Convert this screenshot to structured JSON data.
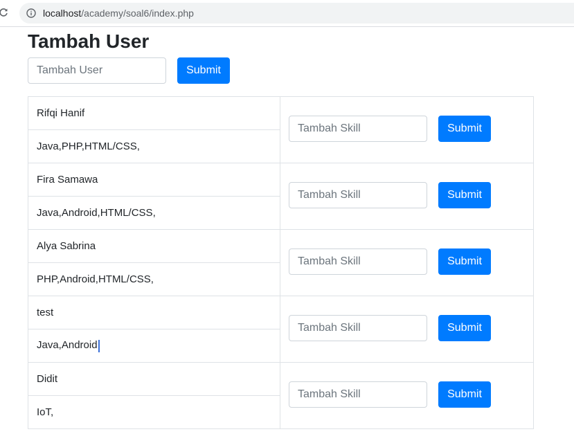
{
  "browser": {
    "url_host": "localhost",
    "url_path": "/academy/soal6/index.php",
    "icons": {
      "reload": "reload-icon",
      "info": "info-icon"
    }
  },
  "page": {
    "title": "Tambah User",
    "user_input_placeholder": "Tambah User",
    "user_submit_label": "Submit"
  },
  "table": {
    "skill_input_placeholder": "Tambah Skill",
    "skill_submit_label": "Submit",
    "rows": [
      {
        "name": "Rifqi Hanif",
        "skills": "Java,PHP,HTML/CSS,"
      },
      {
        "name": "Fira Samawa",
        "skills": "Java,Android,HTML/CSS,"
      },
      {
        "name": "Alya Sabrina",
        "skills": "PHP,Android,HTML/CSS,"
      },
      {
        "name": "test",
        "skills": "Java,Android"
      },
      {
        "name": "Didit",
        "skills": "IoT,"
      }
    ]
  },
  "colors": {
    "primary": "#007bff",
    "border": "#dee2e6"
  }
}
